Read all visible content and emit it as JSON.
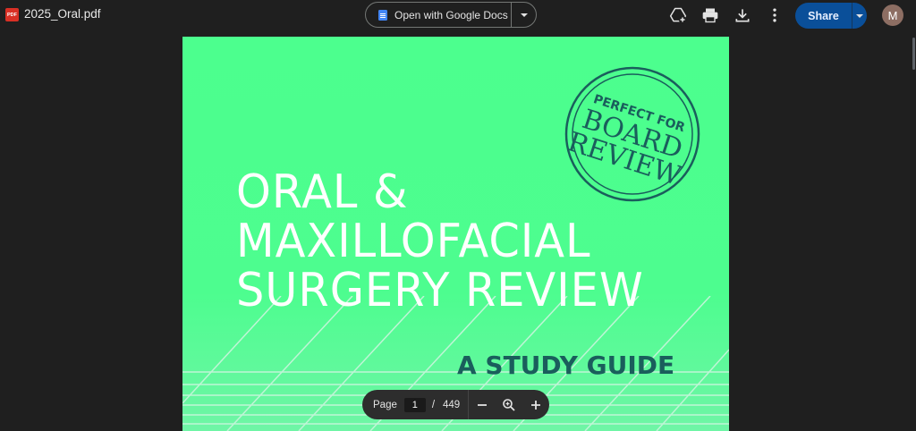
{
  "topbar": {
    "file_icon_text": "PDF",
    "file_name": "2025_Oral.pdf",
    "open_with_label": "Open with Google Docs",
    "share_label": "Share",
    "avatar_initial": "M",
    "icons": [
      "add-to-drive-icon",
      "print-icon",
      "download-icon",
      "more-vert-icon"
    ]
  },
  "document": {
    "stamp": {
      "line1": "PERFECT FOR",
      "line2": "BOARD",
      "line3": "REVIEW"
    },
    "title_lines": [
      "ORAL &",
      "MAXILLOFACIAL",
      "SURGERY REVIEW"
    ],
    "subtitle": "A STUDY GUIDE",
    "colors": {
      "background": "#4cff8e",
      "title": "#ffffff",
      "accent": "#1a5e5c"
    }
  },
  "page_controls": {
    "page_label": "Page",
    "current_page": "1",
    "separator": "/",
    "total_pages": "449"
  }
}
